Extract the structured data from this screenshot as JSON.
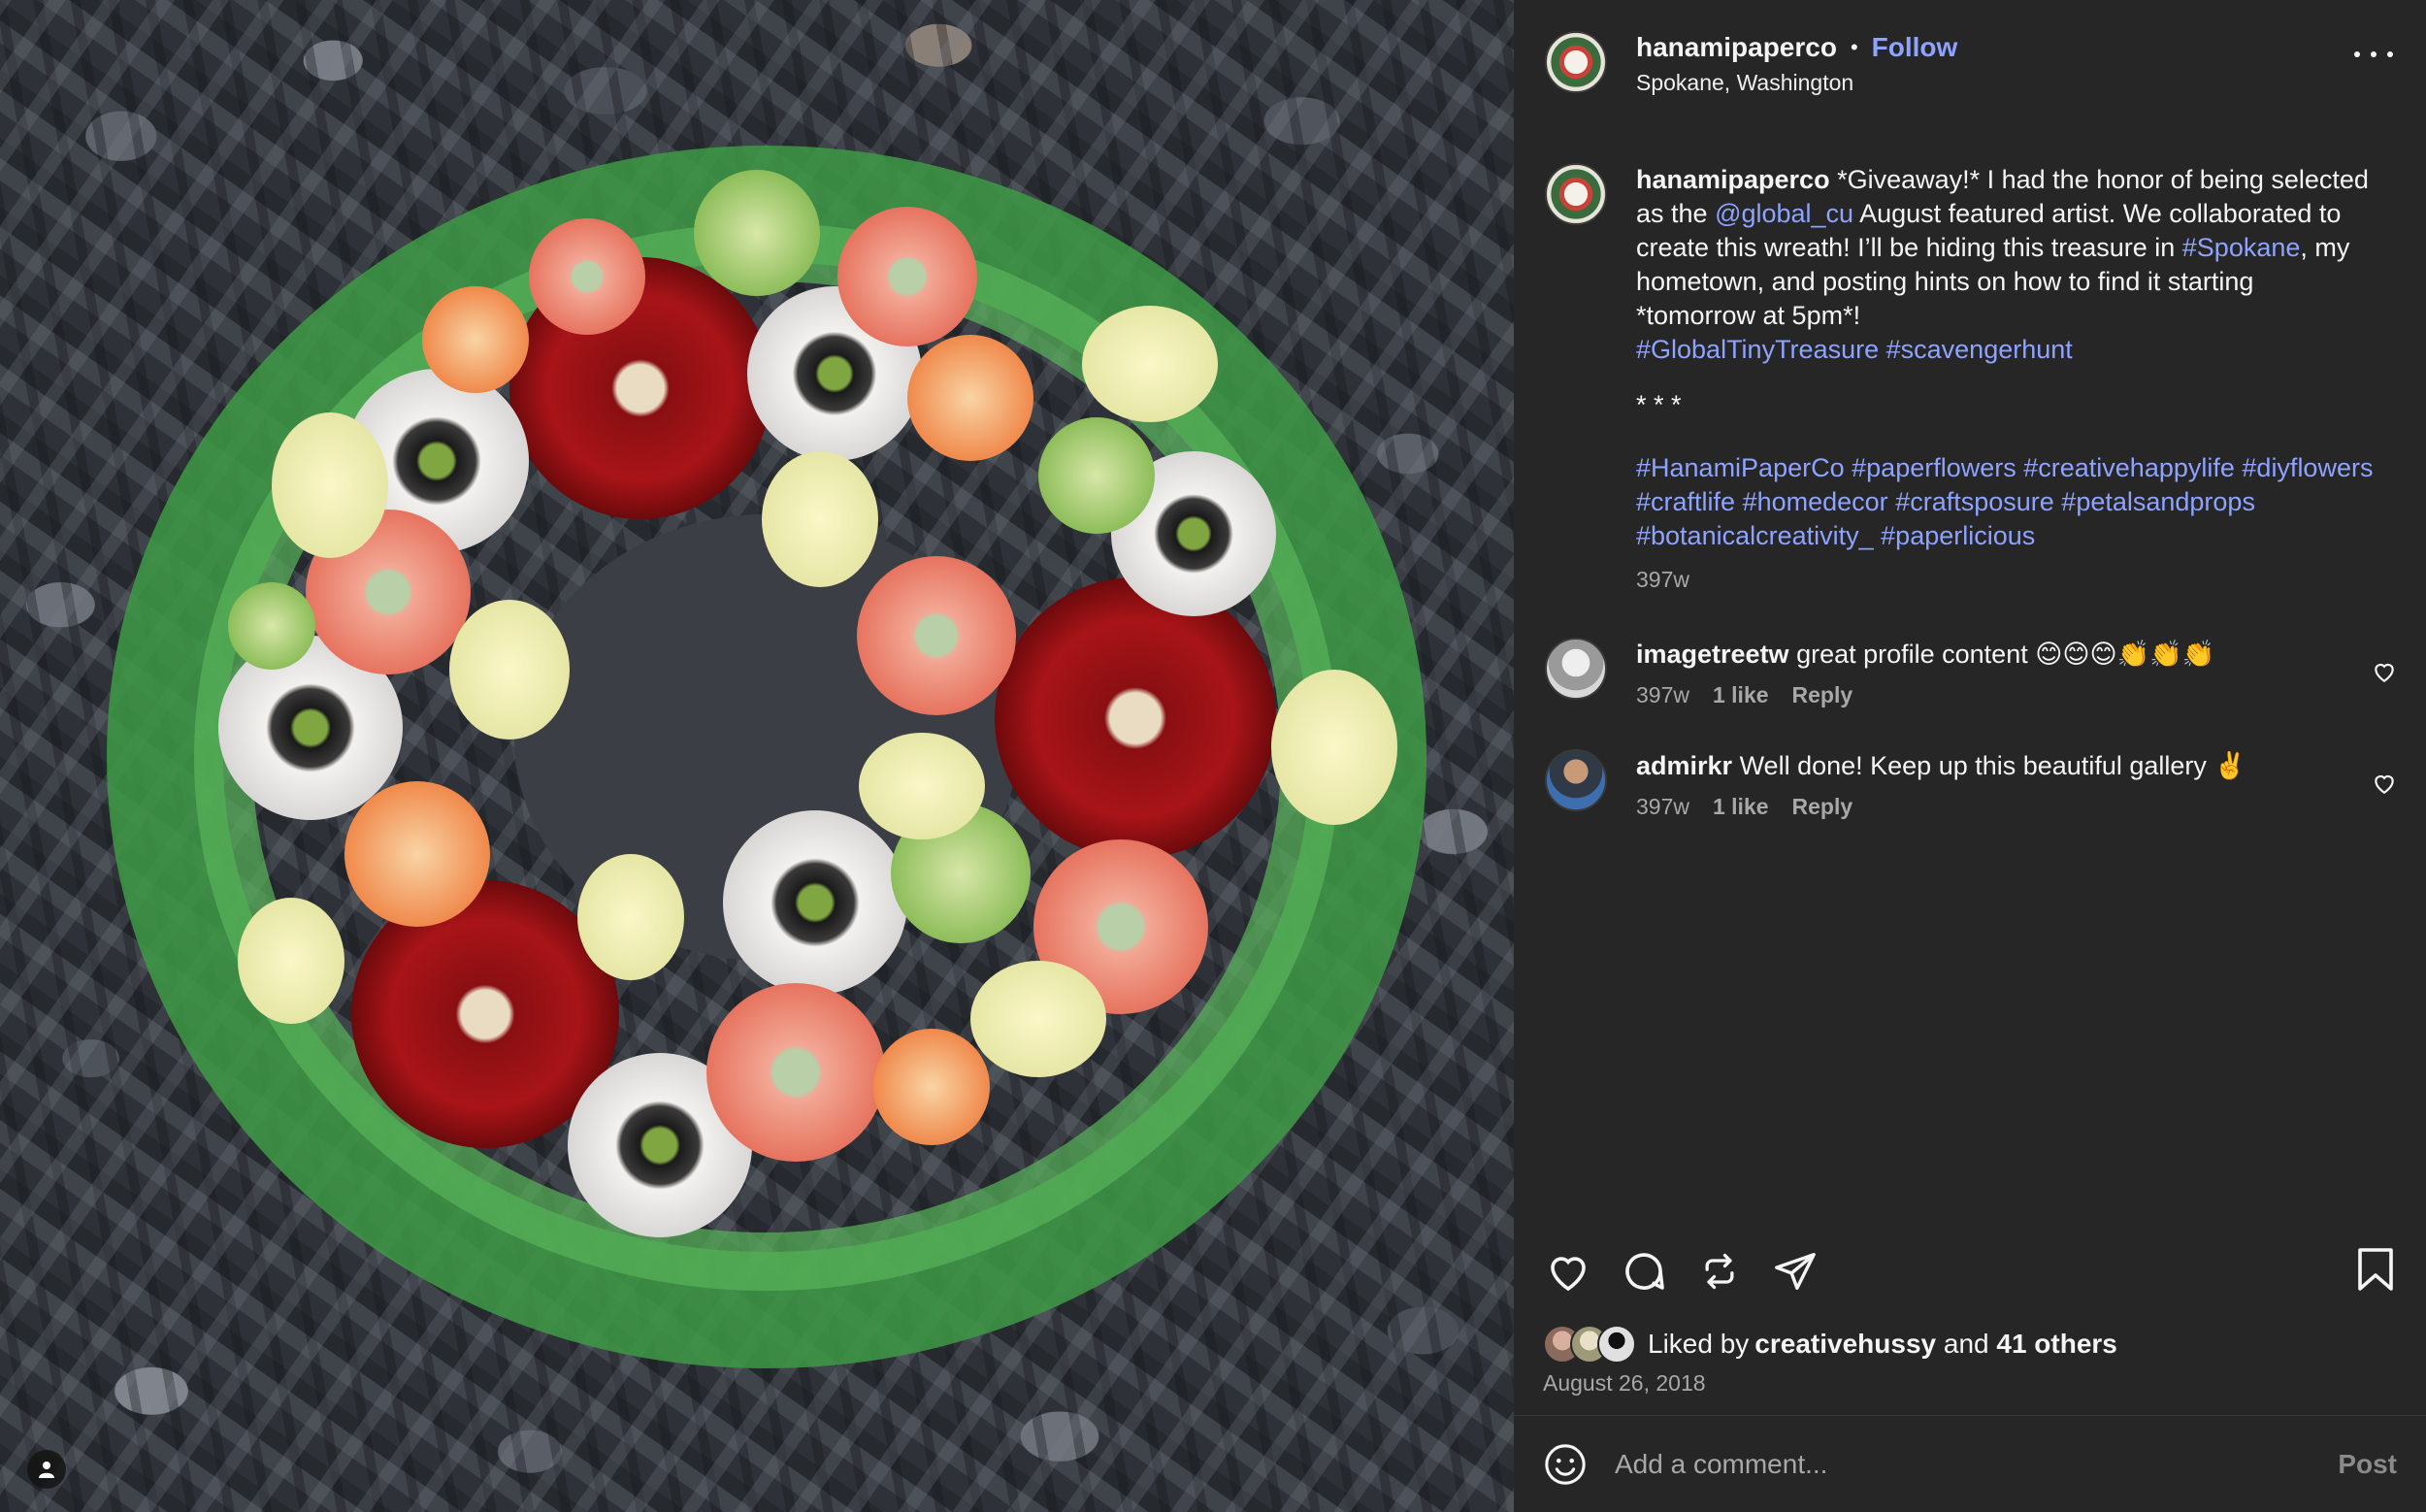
{
  "post": {
    "username": "hanamipaperco",
    "follow_label": "Follow",
    "location": "Spokane, Washington",
    "caption": {
      "username": "hanamipaperco",
      "p1_a": " *Giveaway!* I had the honor of being selected as the ",
      "mention": "@global_cu",
      "p1_b": " August featured artist. We collaborated to create this wreath! I’ll be hiding this treasure in ",
      "tag_spokane": "#Spokane",
      "p1_c": ", my hometown, and posting hints on how to find it starting *tomorrow at 5pm*!",
      "tags1": [
        "#GlobalTinyTreasure",
        "#scavengerhunt"
      ],
      "separator": "* * *",
      "tags2": [
        "#HanamiPaperCo",
        "#paperflowers",
        "#creativehappylife",
        "#diyflowers",
        "#craftlife",
        "#homedecor",
        "#craftsposure",
        "#petalsandprops",
        "#botanicalcreativity_",
        "#paperlicious"
      ],
      "time": "397w"
    }
  },
  "comments": [
    {
      "username": "imagetreetw",
      "text": " great profile content 😊😊😊👏👏👏",
      "time": "397w",
      "likes": "1 like",
      "reply": "Reply"
    },
    {
      "username": "admirkr",
      "text": " Well done! Keep up this beautiful gallery ✌️",
      "time": "397w",
      "likes": "1 like",
      "reply": "Reply"
    }
  ],
  "likes": {
    "prefix": "Liked by ",
    "user": "creativehussy",
    "and": " and ",
    "others": "41 others"
  },
  "date": "August 26, 2018",
  "composer": {
    "placeholder": "Add a comment...",
    "post_label": "Post"
  },
  "colors": {
    "panel": "#262626",
    "link": "#8ea3ff",
    "muted": "#a8a8a8"
  }
}
